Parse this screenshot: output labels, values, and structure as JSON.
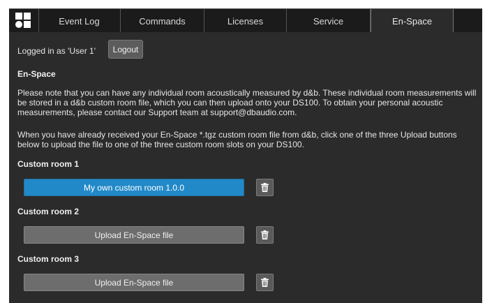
{
  "tabs": [
    {
      "label": "Event Log",
      "active": false
    },
    {
      "label": "Commands",
      "active": false
    },
    {
      "label": "Licenses",
      "active": false
    },
    {
      "label": "Service",
      "active": false
    },
    {
      "label": "En-Space",
      "active": true
    }
  ],
  "login": {
    "status_text": "Logged in as 'User 1'",
    "logout_label": "Logout"
  },
  "section": {
    "title": "En-Space",
    "paragraph1": "Please note that you can have any individual room acoustically measured by d&b. These individual room measurements will be stored in a d&b custom room file, which you can then upload onto your DS100. To obtain your personal acoustic measurements, please contact our Support team at support@dbaudio.com.",
    "paragraph2": "When you have already received your En-Space *.tgz custom room file from d&b, click one of the three Upload buttons below to upload the file to one of the three custom room slots on your DS100."
  },
  "rooms": [
    {
      "title": "Custom room 1",
      "button_label": "My own custom room 1.0.0",
      "state": "loaded"
    },
    {
      "title": "Custom room 2",
      "button_label": "Upload En-Space file",
      "state": "empty"
    },
    {
      "title": "Custom room 3",
      "button_label": "Upload En-Space file",
      "state": "empty"
    }
  ],
  "colors": {
    "background": "#2b2b2b",
    "tabbar": "#1b1b1b",
    "accent_blue": "#2289c8",
    "button_grey": "#6d6d6d"
  },
  "icons": {
    "logo": "db-logo-icon",
    "delete": "trash-icon"
  }
}
